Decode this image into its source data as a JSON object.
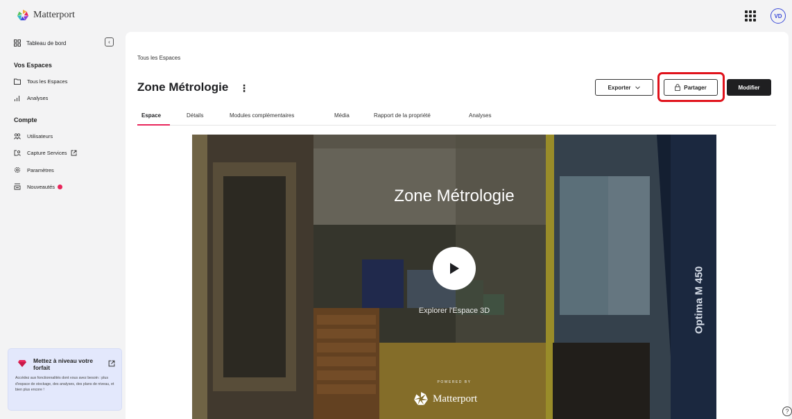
{
  "app": {
    "logo_text": "Matterport",
    "avatar_initials": "VD"
  },
  "sidebar": {
    "dashboard_label": "Tableau de bord",
    "section_spaces": "Vos Espaces",
    "items_spaces": [
      {
        "label": "Tous les Espaces",
        "icon": "folder-icon"
      },
      {
        "label": "Analyses",
        "icon": "bar-chart-icon"
      }
    ],
    "section_account": "Compte",
    "items_account": [
      {
        "label": "Utilisateurs",
        "icon": "users-icon"
      },
      {
        "label": "Capture Services",
        "icon": "capture-services-icon"
      },
      {
        "label": "Paramètres",
        "icon": "gear-icon"
      },
      {
        "label": "Nouveautés",
        "icon": "news-icon"
      }
    ],
    "upgrade": {
      "title": "Mettez à niveau votre forfait",
      "description": "Accédez aux fonctionnalités dont vous avez besoin : plus d'espace de stockage, des analyses, des plans de niveau, et bien plus encore !"
    }
  },
  "main": {
    "breadcrumb": "Tous les Espaces",
    "title": "Zone Métrologie",
    "buttons": {
      "export": "Exporter",
      "share": "Partager",
      "modify": "Modifier"
    },
    "tabs": [
      {
        "label": "Espace",
        "active": true
      },
      {
        "label": "Détails",
        "active": false
      },
      {
        "label": "Modules complémentaires",
        "active": false
      },
      {
        "label": "Média",
        "active": false
      },
      {
        "label": "Rapport de la propriété",
        "active": false
      },
      {
        "label": "Analyses",
        "active": false
      }
    ],
    "viewer": {
      "title": "Zone Métrologie",
      "explore_label": "Explorer l'Espace 3D",
      "powered_by": "POWERED BY",
      "brand": "Matterport",
      "machine_label": "Optima M 450"
    }
  },
  "colors": {
    "accent": "#e8255a",
    "highlight_box": "#e0121b",
    "avatar": "#3b4bd8",
    "primary_button": "#1f1f21"
  }
}
